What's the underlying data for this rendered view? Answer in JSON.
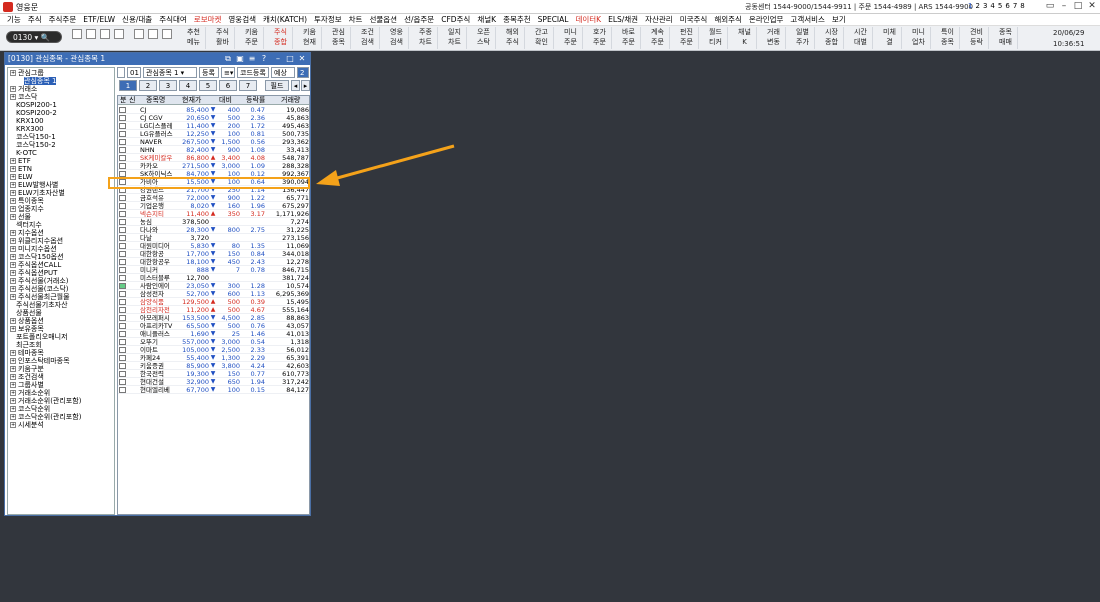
{
  "window_title": "영웅문",
  "header_info": "공동센터 1544-9000/1544-9911 | 주문 1544-4989 | ARS 1544-9900",
  "page_numbers": [
    "1",
    "2",
    "3",
    "4",
    "5",
    "6",
    "7",
    "8"
  ],
  "menu": [
    "기능",
    "주식",
    "주식주문",
    "ETF/ELW",
    "신용/대출",
    "주식대여",
    "로보마켓",
    "영웅검색",
    "캐치(KATCH)",
    "투자정보",
    "차트",
    "선물옵션",
    "선/옵주문",
    "CFD주식",
    "채널K",
    "종목추천",
    "SPECIAL",
    "데이터K",
    "ELS/채권",
    "자산관리",
    "미국주식",
    "해외주식",
    "온라인업무",
    "고객서비스",
    "보기"
  ],
  "toolbar_code": "0130",
  "toolbar_buttons": [
    [
      "추천",
      "메뉴"
    ],
    [
      "주식",
      "활바"
    ],
    [
      "키움",
      "주문"
    ],
    [
      "주식",
      "종합"
    ],
    [
      "키움",
      "현재"
    ],
    [
      "관심",
      "종목"
    ],
    [
      "조건",
      "검색"
    ],
    [
      "영웅",
      "검색"
    ],
    [
      "주종",
      "차트"
    ],
    [
      "일지",
      "차트"
    ],
    [
      "오픈",
      "스탁"
    ],
    [
      "해외",
      "주식"
    ],
    [
      "간고",
      "확인"
    ],
    [
      "미니",
      "주문"
    ],
    [
      "호가",
      "주문"
    ],
    [
      "바로",
      "주문"
    ],
    [
      "계속",
      "주문"
    ],
    [
      "펀진",
      "주문"
    ],
    [
      "월드",
      "티커"
    ],
    [
      "채널",
      "K"
    ],
    [
      "거래",
      "변동"
    ],
    [
      "일별",
      "주가"
    ],
    [
      "시장",
      "종합"
    ],
    [
      "시간",
      "대별"
    ],
    [
      "미체",
      "결"
    ],
    [
      "미니",
      "업차"
    ],
    [
      "특이",
      "종목"
    ],
    [
      "견비",
      "등락"
    ],
    [
      "종목",
      "매매"
    ]
  ],
  "date": "20/06/29",
  "time": "10:36:51",
  "panel_title": "[0130] 관심종목 - 관심종목 1",
  "tree": [
    "관심그룹",
    "관심종목 1",
    "거래소",
    "코스닥",
    "KOSPI200-1",
    "KOSPI200-2",
    "KRX100",
    "KRX300",
    "코스닥150-1",
    "코스닥150-2",
    "K-OTC",
    "ETF",
    "ETN",
    "ELW",
    "ELW발행사별",
    "ELW기초자산별",
    "특이종목",
    "업종지수",
    "선물",
    "섹터지수",
    "지수옵션",
    "위클리지수옵션",
    "미니지수옵션",
    "코스닥150옵션",
    "주식옵션CALL",
    "주식옵션PUT",
    "주식선물(거래소)",
    "주식선물(코스닥)",
    "주식선물최근월물",
    "주식선물기초자산",
    "상품선물",
    "상품옵션",
    "보유종목",
    "포트폴리오매니저",
    "최근조회",
    "테마종목",
    "인포스탁테마종목",
    "키움구분",
    "조건검색",
    "그룹사별",
    "거래소순위",
    "거래소순위(관리포함)",
    "코스닥순위",
    "코스닥순위(관리포함)",
    "시세분석"
  ],
  "controls": {
    "group_no": "01",
    "group_name": "관심종목 1",
    "reg_btn": "등록",
    "code_btn": "코드등록",
    "expect": "예상",
    "page": "2",
    "field": "필드"
  },
  "pages": [
    "1",
    "2",
    "3",
    "4",
    "5",
    "6",
    "7"
  ],
  "columns": [
    "분",
    "신",
    "종목명",
    "현재가",
    "대비",
    "등락률",
    "거래량"
  ],
  "rows": [
    {
      "nm": "CJ",
      "pr": "85,400",
      "ar": "▼",
      "ch": "400",
      "rt": "0.47",
      "vl": "19,086",
      "c": "blue"
    },
    {
      "nm": "CJ CGV",
      "pr": "20,650",
      "ar": "▼",
      "ch": "500",
      "rt": "2.36",
      "vl": "45,863",
      "c": "blue"
    },
    {
      "nm": "LG디스플레",
      "pr": "11,400",
      "ar": "▼",
      "ch": "200",
      "rt": "1.72",
      "vl": "495,463",
      "c": "blue"
    },
    {
      "nm": "LG유플러스",
      "pr": "12,250",
      "ar": "▼",
      "ch": "100",
      "rt": "0.81",
      "vl": "500,735",
      "c": "blue"
    },
    {
      "nm": "NAVER",
      "pr": "267,500",
      "ar": "▼",
      "ch": "1,500",
      "rt": "0.56",
      "vl": "293,362",
      "c": "blue"
    },
    {
      "nm": "NHN",
      "pr": "82,400",
      "ar": "▼",
      "ch": "900",
      "rt": "1.08",
      "vl": "33,413",
      "c": "blue"
    },
    {
      "nm": "SK케미칼우",
      "pr": "86,800",
      "ar": "▲",
      "ch": "3,400",
      "rt": "4.08",
      "vl": "548,787",
      "c": "red"
    },
    {
      "nm": "카카오",
      "pr": "271,500",
      "ar": "▼",
      "ch": "3,000",
      "rt": "1.09",
      "vl": "288,328",
      "c": "blue"
    },
    {
      "nm": "SK하이닉스",
      "pr": "84,700",
      "ar": "▼",
      "ch": "100",
      "rt": "0.12",
      "vl": "992,367",
      "c": "blue"
    },
    {
      "nm": "가비아",
      "pr": "15,500",
      "ar": "▼",
      "ch": "100",
      "rt": "0.64",
      "vl": "390,094",
      "c": "blue"
    },
    {
      "nm": "강원랜드",
      "pr": "21,700",
      "ar": "▼",
      "ch": "250",
      "rt": "1.14",
      "vl": "136,447",
      "c": "blue"
    },
    {
      "nm": "금호석유",
      "pr": "72,000",
      "ar": "▼",
      "ch": "900",
      "rt": "1.22",
      "vl": "65,771",
      "c": "blue"
    },
    {
      "nm": "기업은행",
      "pr": "8,020",
      "ar": "▼",
      "ch": "160",
      "rt": "1.96",
      "vl": "675,297",
      "c": "blue"
    },
    {
      "nm": "넥슨지티",
      "pr": "11,400",
      "ar": "▲",
      "ch": "350",
      "rt": "3.17",
      "vl": "1,171,926",
      "c": "red"
    },
    {
      "nm": "농심",
      "pr": "378,500",
      "ar": "",
      "ch": "",
      "rt": "",
      "vl": "7,274",
      "c": "blk"
    },
    {
      "nm": "다나와",
      "pr": "28,300",
      "ar": "▼",
      "ch": "800",
      "rt": "2.75",
      "vl": "31,225",
      "c": "blue"
    },
    {
      "nm": "다날",
      "pr": "3,720",
      "ar": "",
      "ch": "",
      "rt": "",
      "vl": "273,156",
      "c": "blk"
    },
    {
      "nm": "대원미디어",
      "pr": "5,830",
      "ar": "▼",
      "ch": "80",
      "rt": "1.35",
      "vl": "11,069",
      "c": "blue"
    },
    {
      "nm": "대한항공",
      "pr": "17,700",
      "ar": "▼",
      "ch": "150",
      "rt": "0.84",
      "vl": "344,018",
      "c": "blue"
    },
    {
      "nm": "대한항공우",
      "pr": "18,100",
      "ar": "▼",
      "ch": "450",
      "rt": "2.43",
      "vl": "12,278",
      "c": "blue"
    },
    {
      "nm": "미니커",
      "pr": "888",
      "ar": "▼",
      "ch": "7",
      "rt": "0.78",
      "vl": "846,715",
      "c": "blue"
    },
    {
      "nm": "미스터블루",
      "pr": "12,700",
      "ar": "",
      "ch": "",
      "rt": "",
      "vl": "381,724",
      "c": "blk"
    },
    {
      "nm": "사람인에이",
      "pr": "23,050",
      "ar": "▼",
      "ch": "300",
      "rt": "1.28",
      "vl": "10,574",
      "c": "blue"
    },
    {
      "nm": "삼성전자",
      "pr": "52,700",
      "ar": "▼",
      "ch": "600",
      "rt": "1.13",
      "vl": "6,295,369",
      "c": "blue"
    },
    {
      "nm": "삼양식품",
      "pr": "129,500",
      "ar": "▲",
      "ch": "500",
      "rt": "0.39",
      "vl": "15,495",
      "c": "red"
    },
    {
      "nm": "삼천리자전",
      "pr": "11,200",
      "ar": "▲",
      "ch": "500",
      "rt": "4.67",
      "vl": "555,164",
      "c": "red"
    },
    {
      "nm": "아모레퍼시",
      "pr": "153,500",
      "ar": "▼",
      "ch": "4,500",
      "rt": "2.85",
      "vl": "88,863",
      "c": "blue"
    },
    {
      "nm": "아프리카TV",
      "pr": "65,500",
      "ar": "▼",
      "ch": "500",
      "rt": "0.76",
      "vl": "43,057",
      "c": "blue"
    },
    {
      "nm": "애니플러스",
      "pr": "1,690",
      "ar": "▼",
      "ch": "25",
      "rt": "1.46",
      "vl": "41,013",
      "c": "blue"
    },
    {
      "nm": "오뚜기",
      "pr": "557,000",
      "ar": "▼",
      "ch": "3,000",
      "rt": "0.54",
      "vl": "1,318",
      "c": "blue"
    },
    {
      "nm": "이마트",
      "pr": "105,000",
      "ar": "▼",
      "ch": "2,500",
      "rt": "2.33",
      "vl": "56,012",
      "c": "blue"
    },
    {
      "nm": "카페24",
      "pr": "55,400",
      "ar": "▼",
      "ch": "1,300",
      "rt": "2.29",
      "vl": "65,391",
      "c": "blue"
    },
    {
      "nm": "키움증권",
      "pr": "85,900",
      "ar": "▼",
      "ch": "3,800",
      "rt": "4.24",
      "vl": "42,603",
      "c": "blue"
    },
    {
      "nm": "한국전력",
      "pr": "19,300",
      "ar": "▼",
      "ch": "150",
      "rt": "0.77",
      "vl": "610,773",
      "c": "blue"
    },
    {
      "nm": "현대건설",
      "pr": "32,900",
      "ar": "▼",
      "ch": "650",
      "rt": "1.94",
      "vl": "317,242",
      "c": "blue"
    },
    {
      "nm": "현대엘리베",
      "pr": "67,700",
      "ar": "▼",
      "ch": "100",
      "rt": "0.15",
      "vl": "84,127",
      "c": "blue"
    }
  ],
  "highlight_color": "#f4a21a"
}
